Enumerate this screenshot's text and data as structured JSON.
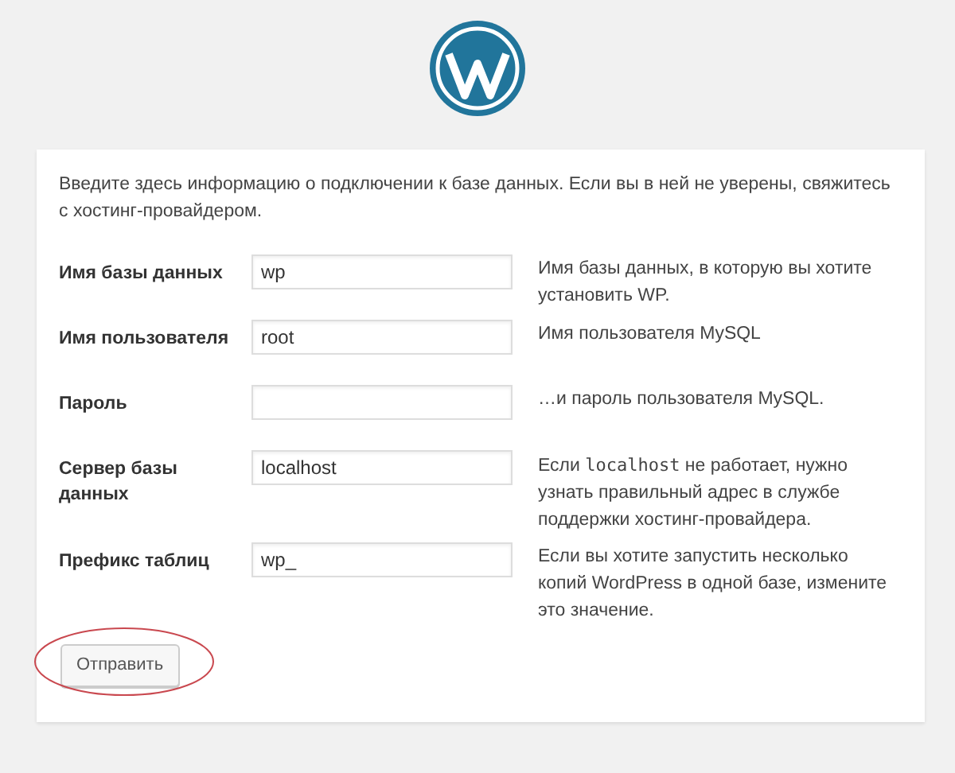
{
  "intro": "Введите здесь информацию о подключении к базе данных. Если вы в ней не уверены, свяжитесь с хостинг-провайдером.",
  "fields": [
    {
      "label": "Имя базы данных",
      "value": "wp",
      "description": [
        {
          "text": "Имя базы данных, в которую вы хотите установить WP."
        }
      ]
    },
    {
      "label": "Имя пользователя",
      "value": "root",
      "description": [
        {
          "text": "Имя пользователя MySQL"
        }
      ]
    },
    {
      "label": "Пароль",
      "description": [
        {
          "text": "…и пароль пользователя MySQL."
        }
      ]
    },
    {
      "label": "Сервер базы данных",
      "value": "localhost",
      "description": [
        {
          "text": "Если "
        },
        {
          "text": "localhost",
          "kind": "code"
        },
        {
          "text": " не работает, нужно узнать правильный адрес в службе поддержки хостинг-провайдера."
        }
      ]
    },
    {
      "label": "Префикс таблиц",
      "value": "wp_",
      "description": [
        {
          "text": "Если вы хотите запустить несколько копий WordPress в одной базе, измените это значение."
        }
      ]
    }
  ],
  "submit": {
    "label": "Отправить",
    "circled": true
  }
}
